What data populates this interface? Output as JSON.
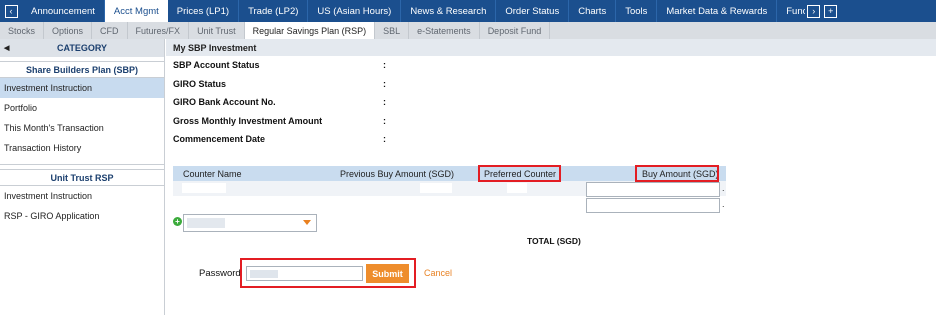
{
  "topnav": {
    "tabs": [
      {
        "label": "Announcement"
      },
      {
        "label": "Acct Mgmt",
        "active": true
      },
      {
        "label": "Prices (LP1)"
      },
      {
        "label": "Trade (LP2)"
      },
      {
        "label": "US (Asian Hours)"
      },
      {
        "label": "News & Research"
      },
      {
        "label": "Order Status"
      },
      {
        "label": "Charts"
      },
      {
        "label": "Tools"
      },
      {
        "label": "Market Data & Rewards"
      },
      {
        "label": "Func"
      }
    ],
    "back_glyph": "‹",
    "next_glyph": "›",
    "add_glyph": "+"
  },
  "subnav": {
    "tabs": [
      {
        "label": "Stocks"
      },
      {
        "label": "Options"
      },
      {
        "label": "CFD"
      },
      {
        "label": "Futures/FX"
      },
      {
        "label": "Unit Trust"
      },
      {
        "label": "Regular Savings Plan (RSP)",
        "active": true
      },
      {
        "label": "SBL"
      },
      {
        "label": "e-Statements"
      },
      {
        "label": "Deposit Fund"
      }
    ]
  },
  "sidebar": {
    "category": "CATEGORY",
    "collapse_glyph": "◀",
    "groups": [
      {
        "title": "Share Builders Plan (SBP)",
        "items": [
          {
            "label": "Investment Instruction",
            "active": true
          },
          {
            "label": "Portfolio"
          },
          {
            "label": "This Month's Transaction"
          },
          {
            "label": "Transaction History"
          }
        ]
      },
      {
        "title": "Unit Trust RSP",
        "items": [
          {
            "label": "Investment Instruction"
          },
          {
            "label": "RSP - GIRO Application"
          }
        ]
      }
    ]
  },
  "main": {
    "title": "My SBP Investment",
    "info": [
      {
        "label": "SBP Account Status",
        "sep": ":"
      },
      {
        "label": "GIRO Status",
        "sep": ":"
      },
      {
        "label": "GIRO Bank Account No.",
        "sep": ":"
      },
      {
        "label": "Gross Monthly Investment Amount",
        "sep": ":"
      },
      {
        "label": "Commencement Date",
        "sep": ":"
      }
    ],
    "table": {
      "col_counter": "Counter Name",
      "col_prev": "Previous Buy Amount (SGD)",
      "col_pref": "Preferred Counter",
      "col_buy": "Buy Amount (SGD)"
    },
    "add_glyph": "+",
    "total_label": "TOTAL (SGD)",
    "row_dot": ".",
    "password_label": "Password",
    "submit_label": "Submit",
    "cancel_label": "Cancel"
  },
  "colors": {
    "nav_bg": "#1b4f8e",
    "highlight_red": "#e31d23",
    "submit_orange": "#ee8d2c",
    "active_sidebar": "#c8dbef"
  }
}
